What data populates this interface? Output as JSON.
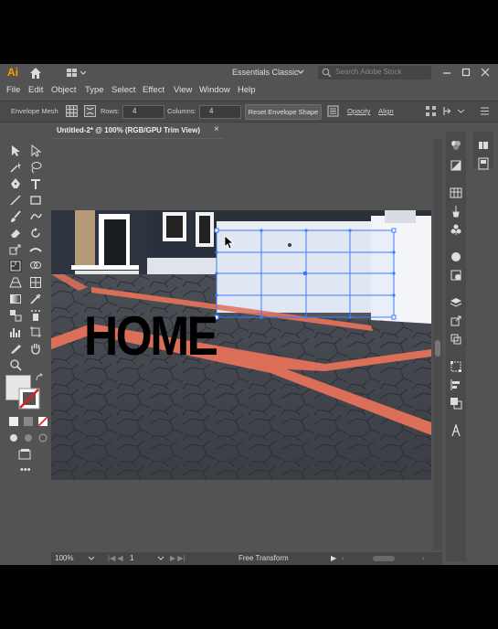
{
  "app": {
    "logo": "Ai",
    "workspace": "Essentials Classic",
    "search_placeholder": "Search Adobe Stock"
  },
  "menu": [
    "File",
    "Edit",
    "Object",
    "Type",
    "Select",
    "Effect",
    "View",
    "Window",
    "Help"
  ],
  "control_bar": {
    "mode_label": "Envelope Mesh",
    "rows_label": "Rows:",
    "rows_value": "4",
    "columns_label": "Columns:",
    "columns_value": "4",
    "reset_button": "Reset Envelope Shape",
    "opacity_label": "Opacity",
    "align_label": "Align"
  },
  "document": {
    "tab_title": "Untitled-2* @ 100% (RGB/GPU Trim View)",
    "close": "×"
  },
  "artwork": {
    "headline": "HOME"
  },
  "status_bar": {
    "zoom": "100%",
    "artboard": "1",
    "tool_name": "Free Transform"
  },
  "colors": {
    "ui_bg": "#535353",
    "accent_orange": "#ff9a00",
    "mesh_blue": "#3b7bff",
    "path_red": "#e9735a"
  }
}
